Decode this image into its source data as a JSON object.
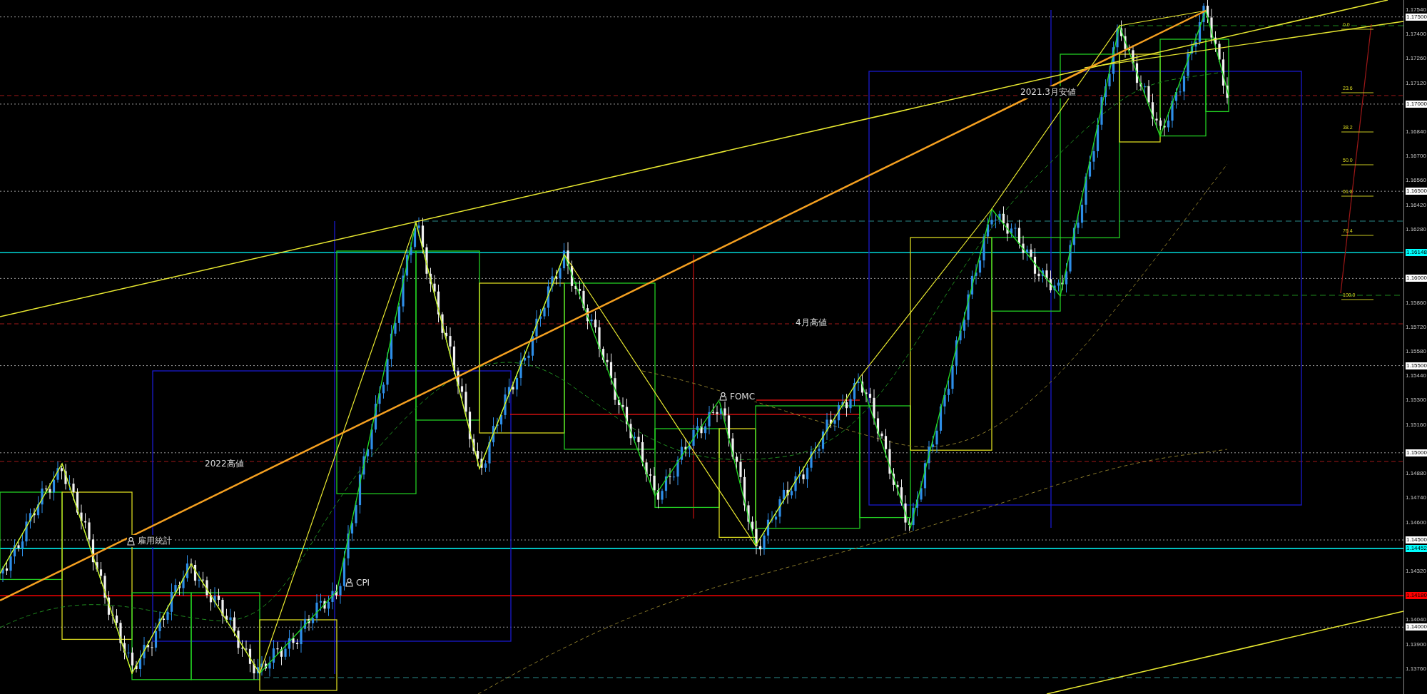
{
  "price_axis": {
    "labels": [
      {
        "text": "1.17540",
        "kind": "tick"
      },
      {
        "text": "1.17500",
        "kind": "level",
        "color": "#ffffff"
      },
      {
        "text": "1.17400",
        "kind": "tick"
      },
      {
        "text": "1.17260",
        "kind": "tick"
      },
      {
        "text": "1.17120",
        "kind": "tick"
      },
      {
        "text": "1.17000",
        "kind": "level",
        "color": "#ffffff"
      },
      {
        "text": "1.16840",
        "kind": "tick"
      },
      {
        "text": "1.16700",
        "kind": "tick"
      },
      {
        "text": "1.16560",
        "kind": "tick"
      },
      {
        "text": "1.16500",
        "kind": "level",
        "color": "#ffffff"
      },
      {
        "text": "1.16420",
        "kind": "tick"
      },
      {
        "text": "1.16280",
        "kind": "tick"
      },
      {
        "text": "1.16148",
        "kind": "level",
        "color": "#00ffff"
      },
      {
        "text": "1.16000",
        "kind": "level",
        "color": "#ffffff"
      },
      {
        "text": "1.15860",
        "kind": "tick"
      },
      {
        "text": "1.15720",
        "kind": "tick"
      },
      {
        "text": "1.15580",
        "kind": "tick"
      },
      {
        "text": "1.15500",
        "kind": "level",
        "color": "#ffffff"
      },
      {
        "text": "1.15440",
        "kind": "tick"
      },
      {
        "text": "1.15300",
        "kind": "tick"
      },
      {
        "text": "1.15160",
        "kind": "tick"
      },
      {
        "text": "1.15000",
        "kind": "level",
        "color": "#ffffff"
      },
      {
        "text": "1.14880",
        "kind": "tick"
      },
      {
        "text": "1.14740",
        "kind": "tick"
      },
      {
        "text": "1.14600",
        "kind": "tick"
      },
      {
        "text": "1.14500",
        "kind": "level",
        "color": "#ffffff"
      },
      {
        "text": "1.14452",
        "kind": "level",
        "color": "#00ffff"
      },
      {
        "text": "1.14320",
        "kind": "tick"
      },
      {
        "text": "1.14180",
        "kind": "level",
        "color": "#ff0000"
      },
      {
        "text": "1.14040",
        "kind": "tick"
      },
      {
        "text": "1.14000",
        "kind": "level",
        "color": "#ffffff"
      },
      {
        "text": "1.13900",
        "kind": "tick"
      },
      {
        "text": "1.13760",
        "kind": "tick"
      }
    ]
  },
  "annotations": [
    {
      "text": "2021.3月安値",
      "kind": "label"
    },
    {
      "text": "4月高値",
      "kind": "label"
    },
    {
      "text": "2022高値",
      "kind": "label"
    },
    {
      "text": "雇用統計",
      "kind": "event"
    },
    {
      "text": "CPI",
      "kind": "event"
    },
    {
      "text": "FOMC",
      "kind": "event"
    }
  ],
  "fibonacci": {
    "levels": [
      "0.0",
      "23.6",
      "38.2",
      "50.0",
      "61.8",
      "76.4",
      "100.0"
    ]
  }
}
